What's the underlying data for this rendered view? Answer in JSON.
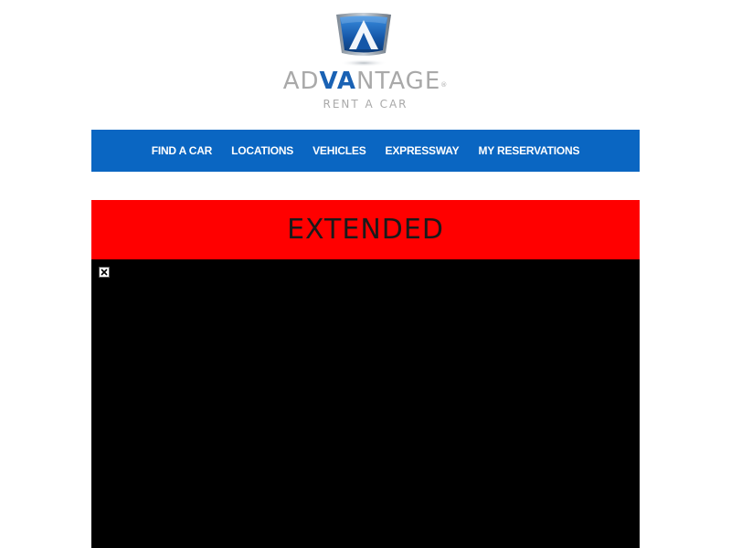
{
  "logo": {
    "icon": "advantage-logo-mark",
    "wordmark_prefix": "AD",
    "wordmark_highlight": "VA",
    "wordmark_suffix": "NTAGE",
    "registered": "®",
    "tagline": "RENT A CAR",
    "colors": {
      "gray": "#a9a9a9",
      "blue": "#1a62b4"
    }
  },
  "nav": {
    "background": "#0a66c2",
    "items": [
      {
        "label": "FIND A CAR"
      },
      {
        "label": "LOCATIONS"
      },
      {
        "label": "VEHICLES"
      },
      {
        "label": "EXPRESSWAY"
      },
      {
        "label": "MY RESERVATIONS"
      }
    ]
  },
  "banner": {
    "text": "EXTENDED",
    "background": "#ff0000"
  },
  "media": {
    "background": "#000000",
    "icon": "broken-image-icon"
  }
}
